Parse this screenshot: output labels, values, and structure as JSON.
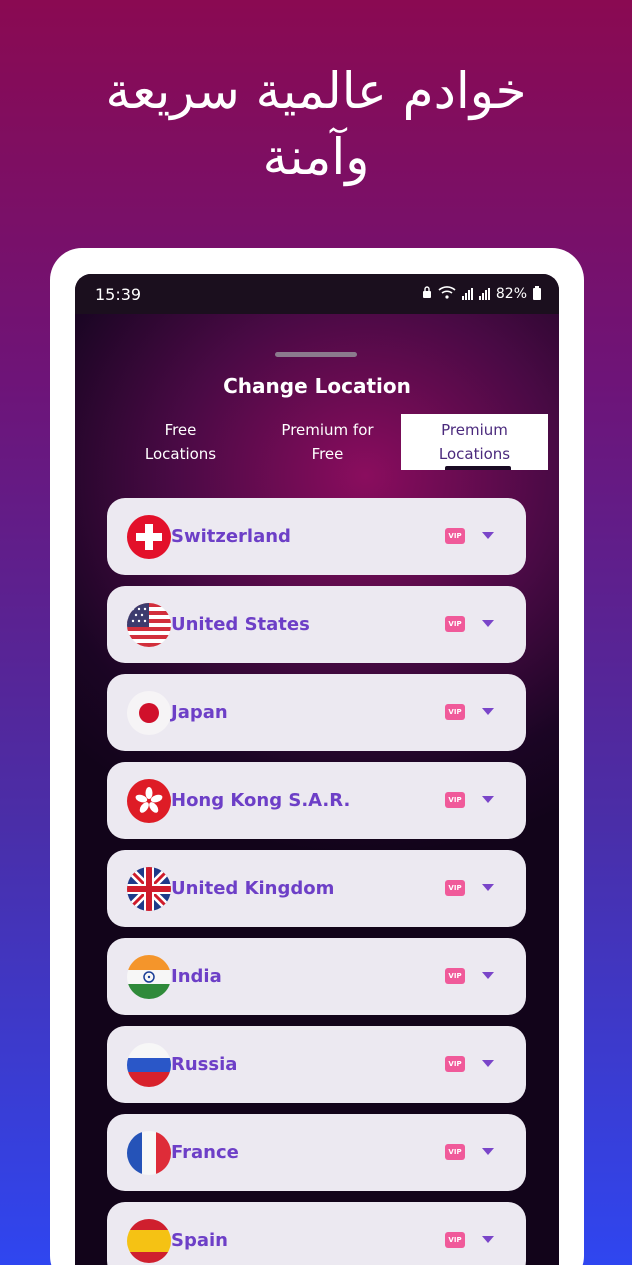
{
  "promo": {
    "headline_line1": "خوادم عالمية سريعة",
    "headline_line2": "وآمنة"
  },
  "statusbar": {
    "time": "15:39",
    "battery": "82%"
  },
  "sheet": {
    "title": "Change Location"
  },
  "tabs": [
    {
      "label_line1": "Free",
      "label_line2": "Locations",
      "active": false
    },
    {
      "label_line1": "Premium for",
      "label_line2": "Free",
      "active": false
    },
    {
      "label_line1": "Premium",
      "label_line2": "Locations",
      "active": true
    }
  ],
  "badge_text": "VIP",
  "locations": [
    {
      "name": "Switzerland",
      "flag": "switzerland-flag-icon"
    },
    {
      "name": "United States",
      "flag": "united-states-flag-icon"
    },
    {
      "name": "Japan",
      "flag": "japan-flag-icon"
    },
    {
      "name": "Hong Kong S.A.R.",
      "flag": "hong-kong-flag-icon"
    },
    {
      "name": "United Kingdom",
      "flag": "united-kingdom-flag-icon"
    },
    {
      "name": "India",
      "flag": "india-flag-icon"
    },
    {
      "name": "Russia",
      "flag": "russia-flag-icon"
    },
    {
      "name": "France",
      "flag": "france-flag-icon"
    },
    {
      "name": "Spain",
      "flag": "spain-flag-icon"
    }
  ],
  "colors": {
    "accent_text": "#6d3fc7",
    "vip_badge": "#f05a9a"
  }
}
